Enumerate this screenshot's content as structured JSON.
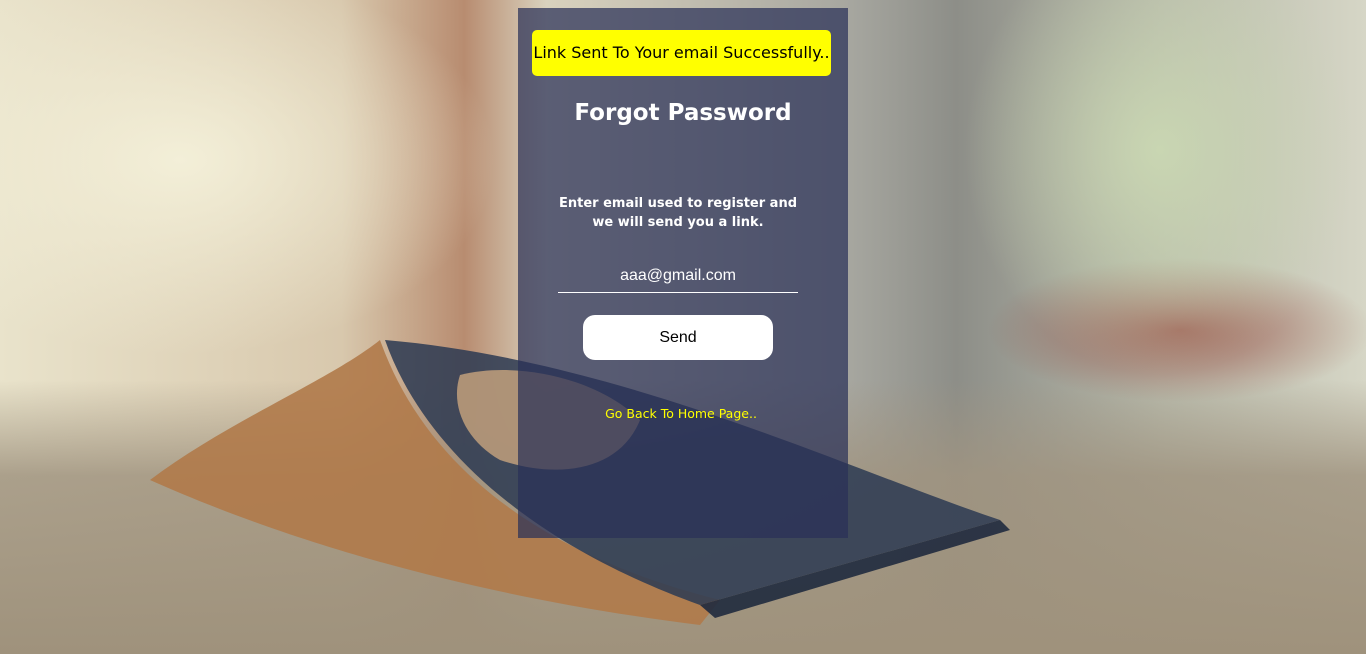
{
  "alert": {
    "message": "Link Sent To Your email Successfully.."
  },
  "form": {
    "title": "Forgot Password",
    "instructions": "Enter email used to register and we will send you a link.",
    "email_value": "aaa@gmail.com",
    "send_label": "Send",
    "back_link": "Go Back To Home Page.."
  },
  "colors": {
    "alert_bg": "#ffff00",
    "card_overlay": "#2a3058",
    "link": "#ffff00"
  }
}
